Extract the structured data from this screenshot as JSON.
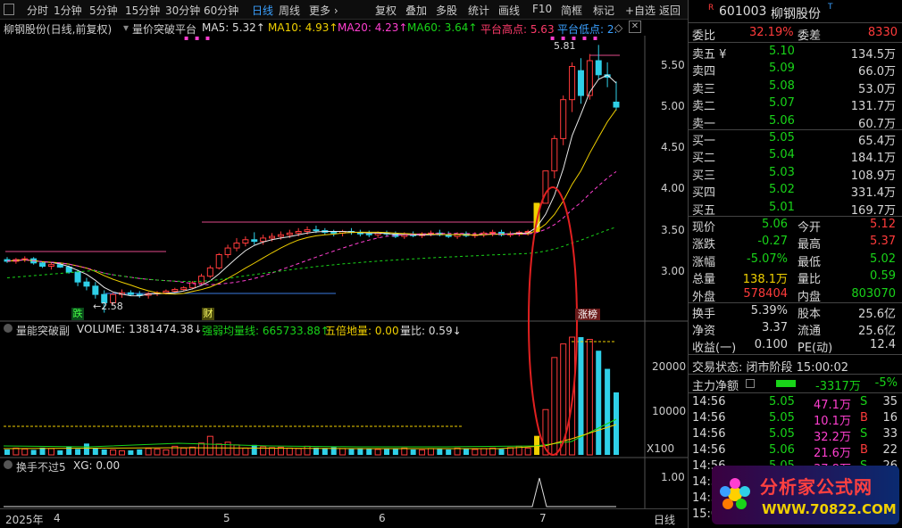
{
  "toolbar": {
    "left": [
      "分时",
      "1分钟",
      "5分钟",
      "15分钟",
      "30分钟",
      "60分钟",
      "日线",
      "周线",
      "更多 ›"
    ],
    "active": "日线",
    "right": [
      "复权",
      "叠加",
      "多股",
      "统计",
      "画线",
      "F10",
      "简框",
      "标记",
      "+自选",
      "返回"
    ]
  },
  "main_legend": {
    "stock": "柳钢股份(日线,前复权)",
    "indicator": "量价突破平台",
    "ma5": "MA5: 5.32↑",
    "ma10": "MA10: 4.93↑",
    "ma20": "MA20: 4.23↑",
    "ma60": "MA60: 3.64↑",
    "high": "平台高点: 5.63",
    "low": "平台低点: 2.",
    "dots1": "▪ ▪ ▪",
    "dots2": "▪ ▪ ▪ ▪ ▪"
  },
  "price_axis": [
    "5.50",
    "5.00",
    "4.50",
    "4.00",
    "3.50",
    "3.00"
  ],
  "price_annotations": {
    "high": "5.81",
    "low": "←2.58"
  },
  "markers": {
    "die": "跌",
    "cai": "财",
    "zhangbang": "涨榜"
  },
  "vol_legend": {
    "name": "量能突破副",
    "volume": "VOLUME: 1381474.38↓",
    "qrjl": "强弱均量线: 665733.88↑",
    "wbdl": "五倍地量: 0.00",
    "lb": "量比: 0.59↓"
  },
  "vol_axis": [
    "20000",
    "10000"
  ],
  "vol_unit": "X100",
  "sub_legend": {
    "name": "换手不过5",
    "xg": "XG: 0.00"
  },
  "sub_axis": "1.00",
  "date_axis": {
    "year": "2025年",
    "months": [
      "4",
      "5",
      "6",
      "7"
    ],
    "period": "日线"
  },
  "quote": {
    "flag": "R",
    "code": "601003",
    "name": "柳钢股份",
    "tag": "T",
    "webi_label": "委比",
    "webi": "32.19%",
    "weicha_label": "委差",
    "weicha": "8330",
    "sell": [
      {
        "label": "卖五 ¥",
        "price": "5.10",
        "vol": "134.5万"
      },
      {
        "label": "卖四",
        "price": "5.09",
        "vol": "66.0万"
      },
      {
        "label": "卖三",
        "price": "5.08",
        "vol": "53.0万"
      },
      {
        "label": "卖二",
        "price": "5.07",
        "vol": "131.7万"
      },
      {
        "label": "卖一",
        "price": "5.06",
        "vol": "60.7万"
      }
    ],
    "buy": [
      {
        "label": "买一",
        "price": "5.05",
        "vol": "65.4万"
      },
      {
        "label": "买二",
        "price": "5.04",
        "vol": "184.1万"
      },
      {
        "label": "买三",
        "price": "5.03",
        "vol": "108.9万"
      },
      {
        "label": "买四",
        "price": "5.02",
        "vol": "331.4万"
      },
      {
        "label": "买五",
        "price": "5.01",
        "vol": "169.7万"
      }
    ],
    "stats": [
      {
        "l1": "现价",
        "v1": "5.06",
        "c1": "green",
        "l2": "今开",
        "v2": "5.12",
        "c2": "red"
      },
      {
        "l1": "涨跌",
        "v1": "-0.27",
        "c1": "green",
        "l2": "最高",
        "v2": "5.37",
        "c2": "red"
      },
      {
        "l1": "涨幅",
        "v1": "-5.07%",
        "c1": "green",
        "l2": "最低",
        "v2": "5.02",
        "c2": "green"
      },
      {
        "l1": "总量",
        "v1": "138.1万",
        "c1": "yellow",
        "l2": "量比",
        "v2": "0.59",
        "c2": "green"
      },
      {
        "l1": "外盘",
        "v1": "578404",
        "c1": "red",
        "l2": "内盘",
        "v2": "803070",
        "c2": "green"
      }
    ],
    "stats2": [
      {
        "l1": "换手",
        "v1": "5.39%",
        "l2": "股本",
        "v2": "25.6亿"
      },
      {
        "l1": "净资",
        "v1": "3.37",
        "l2": "流通",
        "v2": "25.6亿"
      },
      {
        "l1": "收益(一)",
        "v1": "0.100",
        "l2": "PE(动)",
        "v2": "12.4"
      }
    ],
    "status": "交易状态: 闭市阶段 15:00:02",
    "flow_label": "主力净额",
    "flow_value": "-3317万",
    "flow_pct": "-5%",
    "ticks": [
      {
        "t": "14:56",
        "p": "5.05",
        "v": "47.1万",
        "s": "S",
        "n": "35"
      },
      {
        "t": "14:56",
        "p": "5.05",
        "v": "10.1万",
        "s": "B",
        "n": "16"
      },
      {
        "t": "14:56",
        "p": "5.05",
        "v": "32.2万",
        "s": "S",
        "n": "33"
      },
      {
        "t": "14:56",
        "p": "5.06",
        "v": "21.6万",
        "s": "B",
        "n": "22"
      },
      {
        "t": "14:56",
        "p": "5.05",
        "v": "37.8万",
        "s": "S",
        "n": "26"
      },
      {
        "t": "14:5",
        "p": "",
        "v": "",
        "s": "",
        "n": ""
      },
      {
        "t": "14:5",
        "p": "",
        "v": "",
        "s": "",
        "n": ""
      },
      {
        "t": "15:0",
        "p": "",
        "v": "",
        "s": "",
        "n": ""
      }
    ]
  },
  "watermark": {
    "line1": "分析家公式网",
    "line2": "WWW.70822.COM"
  },
  "chart_data": [
    {
      "type": "candlestick",
      "title": "柳钢股份(日线,前复权)",
      "ylim": [
        2.5,
        5.9
      ],
      "series": [
        {
          "name": "MA5",
          "value": 5.32
        },
        {
          "name": "MA10",
          "value": 4.93
        },
        {
          "name": "MA20",
          "value": 4.23
        },
        {
          "name": "MA60",
          "value": 3.64
        }
      ],
      "candles": [
        [
          3.22,
          3.25,
          3.18,
          3.2
        ],
        [
          3.2,
          3.24,
          3.17,
          3.22
        ],
        [
          3.22,
          3.26,
          3.19,
          3.23
        ],
        [
          3.23,
          3.25,
          3.16,
          3.18
        ],
        [
          3.18,
          3.2,
          3.12,
          3.14
        ],
        [
          3.14,
          3.18,
          3.1,
          3.16
        ],
        [
          3.16,
          3.18,
          3.12,
          3.13
        ],
        [
          3.13,
          3.15,
          3.05,
          3.07
        ],
        [
          3.07,
          3.1,
          2.9,
          2.95
        ],
        [
          2.95,
          3.0,
          2.85,
          2.9
        ],
        [
          2.9,
          2.95,
          2.75,
          2.8
        ],
        [
          2.8,
          2.85,
          2.58,
          2.7
        ],
        [
          2.7,
          2.82,
          2.68,
          2.8
        ],
        [
          2.8,
          2.86,
          2.76,
          2.82
        ],
        [
          2.82,
          2.85,
          2.78,
          2.8
        ],
        [
          2.8,
          2.84,
          2.76,
          2.79
        ],
        [
          2.79,
          2.83,
          2.75,
          2.81
        ],
        [
          2.81,
          2.84,
          2.78,
          2.82
        ],
        [
          2.82,
          2.86,
          2.8,
          2.84
        ],
        [
          2.84,
          2.88,
          2.82,
          2.86
        ],
        [
          2.86,
          2.9,
          2.84,
          2.88
        ],
        [
          2.88,
          2.96,
          2.86,
          2.94
        ],
        [
          2.94,
          3.05,
          2.92,
          3.02
        ],
        [
          3.02,
          3.15,
          3.0,
          3.12
        ],
        [
          3.12,
          3.3,
          3.1,
          3.28
        ],
        [
          3.28,
          3.4,
          3.24,
          3.36
        ],
        [
          3.36,
          3.48,
          3.32,
          3.42
        ],
        [
          3.42,
          3.5,
          3.38,
          3.46
        ],
        [
          3.46,
          3.55,
          3.4,
          3.44
        ],
        [
          3.44,
          3.52,
          3.4,
          3.48
        ],
        [
          3.48,
          3.54,
          3.44,
          3.5
        ],
        [
          3.5,
          3.56,
          3.46,
          3.52
        ],
        [
          3.52,
          3.58,
          3.48,
          3.54
        ],
        [
          3.54,
          3.6,
          3.5,
          3.56
        ],
        [
          3.56,
          3.62,
          3.52,
          3.58
        ],
        [
          3.58,
          3.63,
          3.54,
          3.57
        ],
        [
          3.57,
          3.6,
          3.52,
          3.55
        ],
        [
          3.55,
          3.58,
          3.5,
          3.54
        ],
        [
          3.54,
          3.58,
          3.5,
          3.56
        ],
        [
          3.56,
          3.6,
          3.52,
          3.55
        ],
        [
          3.55,
          3.58,
          3.5,
          3.53
        ],
        [
          3.53,
          3.57,
          3.49,
          3.52
        ],
        [
          3.52,
          3.56,
          3.48,
          3.54
        ],
        [
          3.54,
          3.57,
          3.5,
          3.53
        ],
        [
          3.53,
          3.56,
          3.48,
          3.5
        ],
        [
          3.5,
          3.55,
          3.47,
          3.52
        ],
        [
          3.52,
          3.56,
          3.49,
          3.51
        ],
        [
          3.51,
          3.55,
          3.48,
          3.53
        ],
        [
          3.53,
          3.57,
          3.5,
          3.54
        ],
        [
          3.54,
          3.58,
          3.5,
          3.52
        ],
        [
          3.52,
          3.56,
          3.48,
          3.5
        ],
        [
          3.5,
          3.55,
          3.47,
          3.53
        ],
        [
          3.53,
          3.56,
          3.49,
          3.51
        ],
        [
          3.51,
          3.55,
          3.48,
          3.52
        ],
        [
          3.52,
          3.56,
          3.49,
          3.54
        ],
        [
          3.54,
          3.58,
          3.5,
          3.55
        ],
        [
          3.55,
          3.58,
          3.5,
          3.52
        ],
        [
          3.52,
          3.56,
          3.49,
          3.53
        ],
        [
          3.53,
          3.57,
          3.5,
          3.55
        ],
        [
          3.55,
          3.58,
          3.51,
          3.56
        ],
        [
          3.56,
          3.9,
          3.55,
          3.9
        ],
        [
          3.9,
          4.29,
          3.9,
          4.29
        ],
        [
          4.29,
          4.72,
          4.2,
          4.68
        ],
        [
          4.68,
          5.2,
          4.6,
          5.15
        ],
        [
          5.15,
          5.6,
          5.0,
          5.55
        ],
        [
          5.5,
          5.65,
          5.1,
          5.2
        ],
        [
          5.2,
          5.7,
          5.15,
          5.62
        ],
        [
          5.62,
          5.81,
          5.4,
          5.45
        ],
        [
          5.45,
          5.6,
          5.3,
          5.42
        ],
        [
          5.12,
          5.37,
          5.02,
          5.06
        ]
      ]
    },
    {
      "type": "bar",
      "title": "量能突破副",
      "ylim": [
        0,
        26000
      ],
      "values": [
        1200,
        1500,
        1300,
        1100,
        1600,
        1400,
        1000,
        1800,
        1300,
        2500,
        1500,
        1200,
        1100,
        900,
        1000,
        1200,
        1400,
        1300,
        1100,
        1900,
        1500,
        1700,
        2600,
        4100,
        2400,
        2800,
        2200,
        1500,
        2200,
        1800,
        1600,
        1700,
        1500,
        1400,
        1900,
        1600,
        1500,
        1700,
        1400,
        1300,
        1500,
        1300,
        1200,
        1400,
        1300,
        1500,
        1200,
        1100,
        1400,
        1300,
        1200,
        1500,
        1300,
        1200,
        1400,
        1500,
        1300,
        1600,
        1900,
        1500,
        4200,
        10000,
        21500,
        24500,
        26000,
        26000,
        25500,
        23000,
        19000,
        13800
      ]
    }
  ]
}
